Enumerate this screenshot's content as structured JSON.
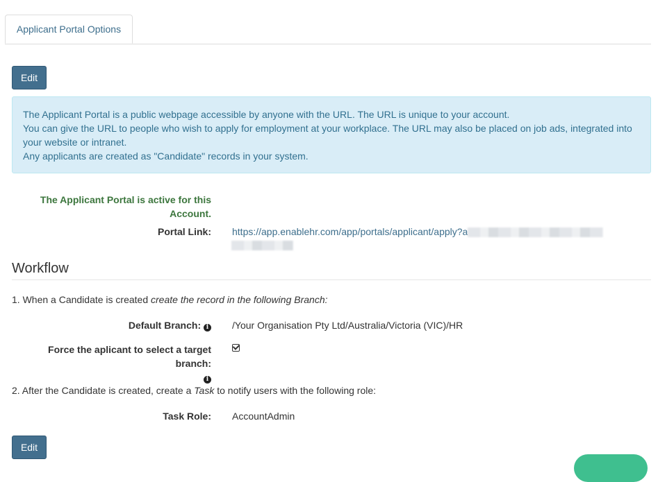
{
  "tabs": [
    {
      "label": "Applicant Portal Options"
    }
  ],
  "buttons": {
    "edit_top": "Edit",
    "edit_bottom": "Edit"
  },
  "info": {
    "lines": [
      "The Applicant Portal is a public webpage accessible by anyone with the URL. The URL is unique to your account.",
      "You can give the URL to people who wish to apply for employment at your workplace. The URL may also be placed on job ads, integrated into your website or intranet.",
      "Any applicants are created as \"Candidate\" records in your system."
    ]
  },
  "portal": {
    "status": "The Applicant Portal is active for this Account.",
    "link_label": "Portal Link:",
    "link_url": "https://app.enablehr.com/app/portals/applicant/apply?a"
  },
  "workflow": {
    "title": "Workflow",
    "step1_prefix": "1. When a Candidate is created ",
    "step1_italic": "create the record in the following Branch:",
    "default_branch_label": "Default Branch:",
    "default_branch_value": "/Your Organisation Pty Ltd/Australia/Victoria (VIC)/HR",
    "force_select_label": "Force the aplicant to select a target branch:",
    "force_select_checked": true,
    "step2_prefix": "2. After the Candidate is created, create a ",
    "step2_italic": "Task",
    "step2_suffix": " to notify users with the following role:",
    "task_role_label": "Task Role:",
    "task_role_value": "AccountAdmin"
  },
  "icons": {
    "info": "info-circle-icon",
    "checkbox": "checked-checkbox-icon"
  },
  "colors": {
    "button": "#436f8e",
    "info_bg": "#d9edf7",
    "info_text": "#31708f",
    "success": "#3c763d",
    "link": "#3d6e8c",
    "chat": "#3fbf8f"
  }
}
